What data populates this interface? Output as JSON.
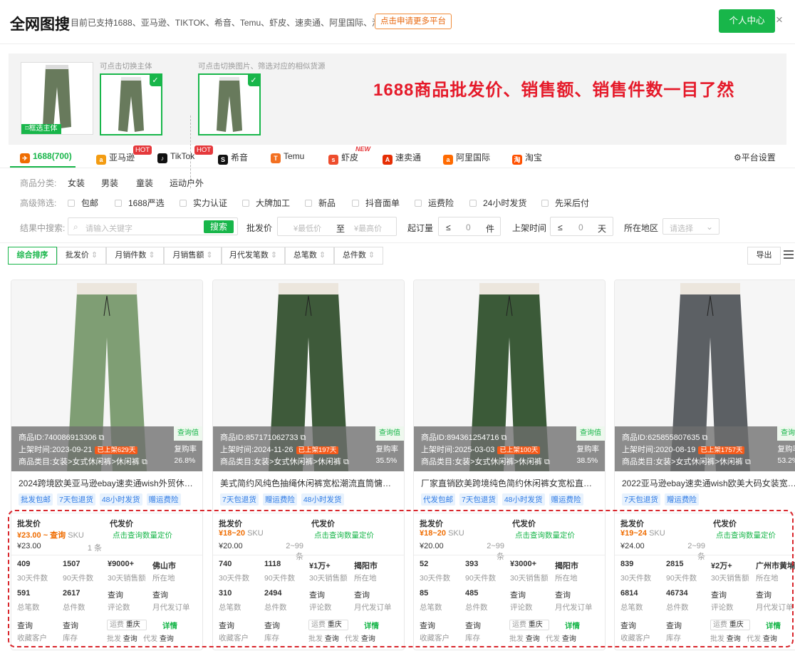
{
  "header": {
    "brand": "全网图搜",
    "subtitle": "目前已支持1688、亚马逊、TIKTOK、希音、Temu、虾皮、速卖通、阿里国际、淘宝",
    "apply_label": "点击申请更多平台",
    "user_center_label": "个人中心",
    "close_glyph": "×"
  },
  "subject": {
    "hint_main": "可点击切换主体",
    "hint_images": "可点击切换图片、筛选对应的相似货源",
    "main_label": "框选主体",
    "promo": "1688商品批发价、销售额、销售件数一目了然"
  },
  "tabs": [
    {
      "label": "1688(700)",
      "icon": "1688-icon",
      "color": "#ef6c00"
    },
    {
      "label": "亚马逊",
      "icon": "amazon-icon",
      "color": "#f39c12",
      "badge": "HOT"
    },
    {
      "label": "TikTok",
      "icon": "tiktok-icon",
      "color": "#111111",
      "badge": "HOT"
    },
    {
      "label": "希音",
      "icon": "shein-icon",
      "color": "#111111"
    },
    {
      "label": "Temu",
      "icon": "temu-icon",
      "color": "#f37021"
    },
    {
      "label": "虾皮",
      "icon": "shopee-icon",
      "color": "#ee4d2d",
      "badge": "NEW"
    },
    {
      "label": "速卖通",
      "icon": "aliexpress-icon",
      "color": "#e62e04"
    },
    {
      "label": "阿里国际",
      "icon": "alibaba-icon",
      "color": "#ff6a00"
    },
    {
      "label": "淘宝",
      "icon": "taobao-icon",
      "color": "#ff5000"
    }
  ],
  "platform_settings": "平台设置",
  "filters": {
    "category_label": "商品分类:",
    "categories": [
      "女装",
      "男装",
      "童装",
      "运动户外"
    ],
    "advanced_label": "高级筛选:",
    "advanced": [
      "包邮",
      "1688严选",
      "实力认证",
      "大牌加工",
      "新品",
      "抖音面单",
      "运费险",
      "24小时发货",
      "先采后付"
    ],
    "search_label": "结果中搜索:",
    "search_placeholder": "请输入关键字",
    "search_btn": "搜索",
    "price_label": "批发价",
    "price_min_ph": "¥最低价",
    "price_to": "至",
    "price_max_ph": "¥最高价",
    "moq_label": "起订量",
    "moq_op": "≤",
    "moq_value": "0",
    "moq_unit": "件",
    "time_label": "上架时间",
    "time_op": "≤",
    "time_value": "0",
    "time_unit": "天",
    "region_label": "所在地区",
    "region_ph": "请选择"
  },
  "sort": {
    "buttons": [
      "综合排序",
      "批发价",
      "月销件数",
      "月销售额",
      "月代发笔数",
      "总笔数",
      "总件数"
    ],
    "export": "导出"
  },
  "labels": {
    "id": "商品ID:",
    "uptime": "上架时间:",
    "cat": "商品类目:",
    "category_value": "女装>女式休闲裤>休闲裤",
    "quality": "查询值",
    "repurchase": "复购率",
    "wholesale": "批发价",
    "dropship": "代发价",
    "dropship_query": "点击查询数量定价",
    "sku": "SKU",
    "d30": "30天件数",
    "d90": "90天件数",
    "sales30": "30天销售额",
    "location": "所在地",
    "orders": "总笔数",
    "total": "总件数",
    "reviews": "评论数",
    "monthly_orders": "月代发订单",
    "fav": "收藏客户",
    "stock": "库存",
    "query": "查询",
    "freight": "运费",
    "city": "重庆",
    "detail": "详情",
    "batch": "批发",
    "daifa": "代发"
  },
  "products": [
    {
      "id": "740086913306",
      "date": "2023-09-21",
      "up": "已上架629天",
      "rate": "26.8%",
      "title": "2024跨境欧美亚马逊ebay速卖通wish外贸休闲裤女裤",
      "tags": [
        "批发包邮",
        "7天包退货",
        "48小时发货",
        "赠运费险"
      ],
      "price": "¥23.00 ~ 查询",
      "base": "¥23.00",
      "moq": "1 条",
      "n30": "409",
      "n90": "1507",
      "sales": "¥9000+",
      "city": "佛山市",
      "orders": "591",
      "total": "2617",
      "color": "#7f9e74"
    },
    {
      "id": "857171062733",
      "date": "2024-11-26",
      "up": "已上架197天",
      "rate": "35.5%",
      "title": "美式简约风纯色抽绳休闲裤宽松潮流直筒慵懒风",
      "tags": [
        "7天包退货",
        "赠运费险",
        "48小时发货"
      ],
      "price": "¥18~20",
      "base": "¥20.00",
      "moq": "2~99 条",
      "n30": "740",
      "n90": "1118",
      "sales": "¥1万+",
      "city": "揭阳市",
      "orders": "310",
      "total": "2494",
      "color": "#3e5a3a"
    },
    {
      "id": "894361254716",
      "date": "2025-03-03",
      "up": "已上架100天",
      "rate": "38.5%",
      "title": "厂家直销欧美跨境纯色简约休闲裤女宽松直筒长裤",
      "tags": [
        "代发包邮",
        "7天包退货",
        "48小时发货",
        "赠运费险"
      ],
      "price": "¥18~20",
      "base": "¥20.00",
      "moq": "2~99 条",
      "n30": "52",
      "n90": "393",
      "sales": "¥3000+",
      "city": "揭阳市",
      "orders": "85",
      "total": "485",
      "color": "#3b5a38"
    },
    {
      "id": "625855807635",
      "date": "2020-08-19",
      "up": "已上架1757天",
      "rate": "53.2%",
      "title": "2022亚马逊ebay速卖通wish欧美大码女装宽松休闲裤",
      "tags": [
        "7天包退货",
        "赠运费险"
      ],
      "price": "¥19~24",
      "base": "¥24.00",
      "moq": "2~99 条",
      "n30": "839",
      "n90": "2815",
      "sales": "¥2万+",
      "city": "广州市黄埔",
      "orders": "6814",
      "total": "46734",
      "color": "#5c6064"
    }
  ]
}
